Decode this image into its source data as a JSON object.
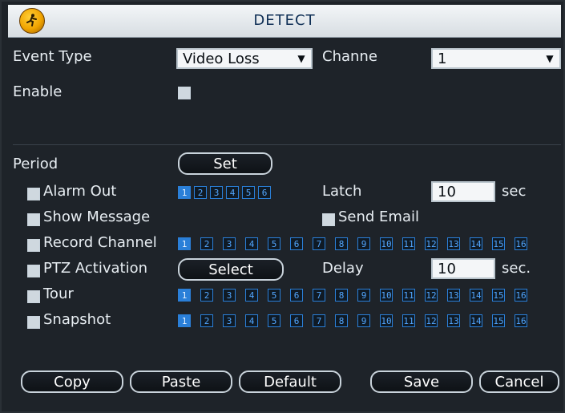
{
  "title": "DETECT",
  "fields": {
    "event_type_label": "Event Type",
    "event_type_value": "Video Loss",
    "channel_label": "Channe",
    "channel_value": "1",
    "enable_label": "Enable",
    "period_label": "Period",
    "set_button": "Set",
    "alarm_out_label": "Alarm Out",
    "alarm_out_channels": [
      "1",
      "2",
      "3",
      "4",
      "5",
      "6"
    ],
    "latch_label": "Latch",
    "latch_value": "10",
    "latch_unit": "sec",
    "show_message_label": "Show Message",
    "send_email_label": "Send Email",
    "record_channel_label": "Record Channel",
    "record_channels": [
      "1",
      "2",
      "3",
      "4",
      "5",
      "6",
      "7",
      "8",
      "9",
      "10",
      "11",
      "12",
      "13",
      "14",
      "15",
      "16"
    ],
    "ptz_activation_label": "PTZ Activation",
    "select_button": "Select",
    "delay_label": "Delay",
    "delay_value": "10",
    "delay_unit": "sec.",
    "tour_label": "Tour",
    "tour_channels": [
      "1",
      "2",
      "3",
      "4",
      "5",
      "6",
      "7",
      "8",
      "9",
      "10",
      "11",
      "12",
      "13",
      "14",
      "15",
      "16"
    ],
    "snapshot_label": "Snapshot",
    "snapshot_channels": [
      "1",
      "2",
      "3",
      "4",
      "5",
      "6",
      "7",
      "8",
      "9",
      "10",
      "11",
      "12",
      "13",
      "14",
      "15",
      "16"
    ]
  },
  "buttons": {
    "copy": "Copy",
    "paste": "Paste",
    "default": "Default",
    "save": "Save",
    "cancel": "Cancel"
  },
  "icons": {
    "logo": "runner-logo-icon",
    "dropdown_arrow": "chevron-down-icon"
  }
}
